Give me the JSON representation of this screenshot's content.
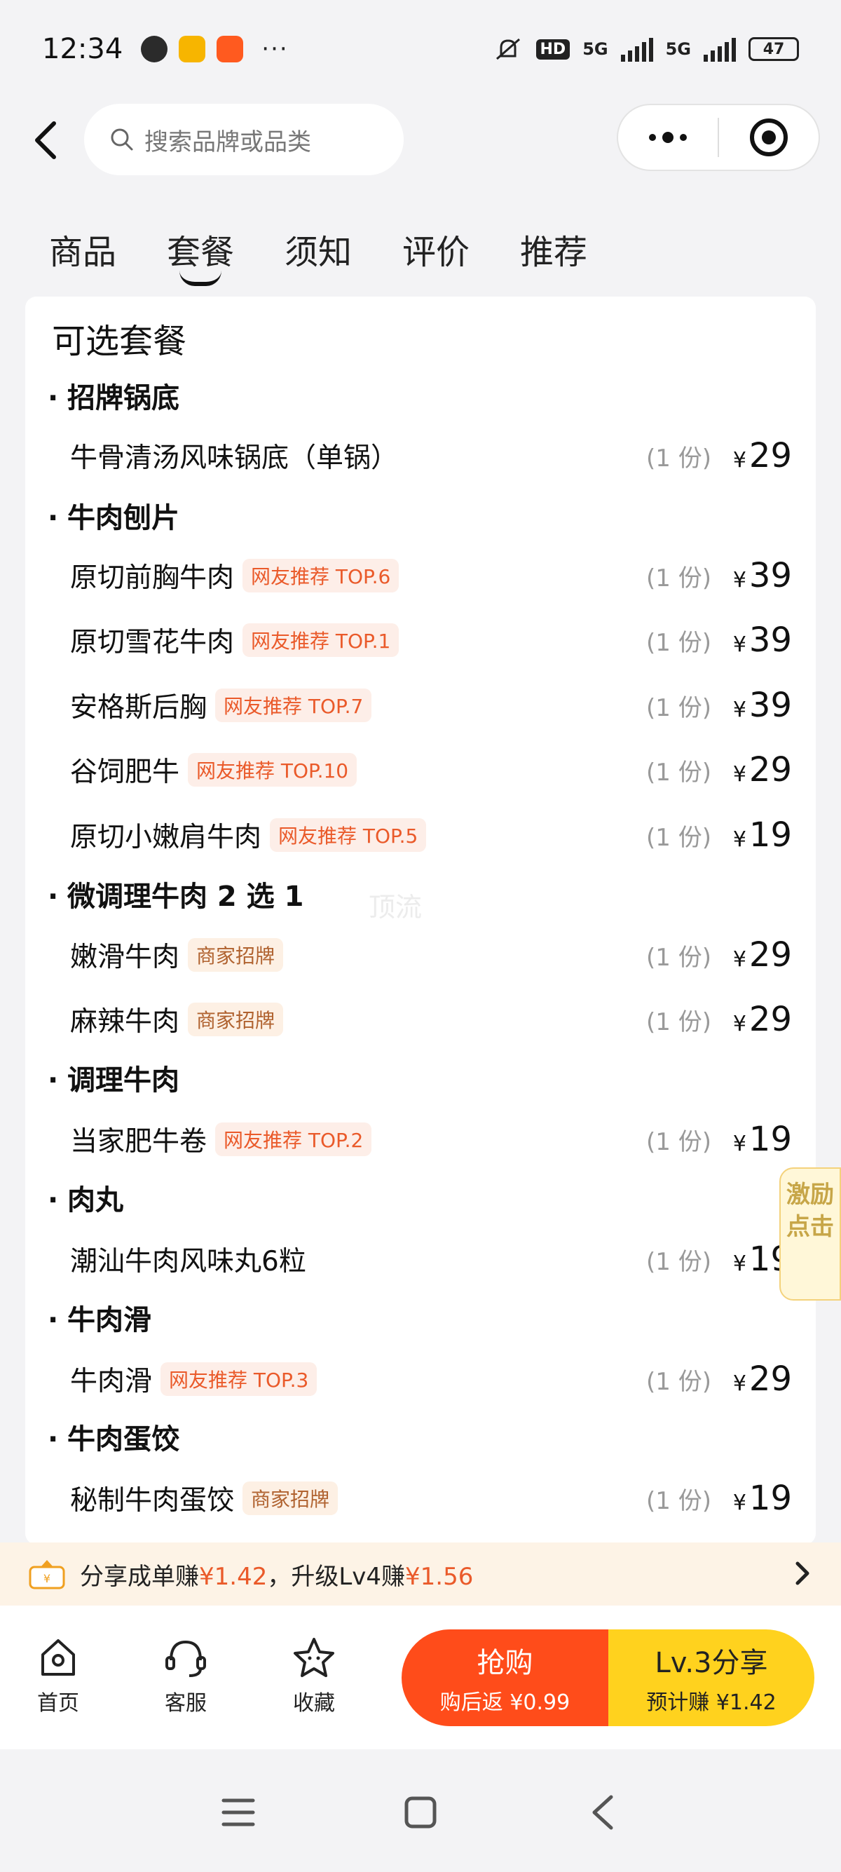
{
  "status_bar": {
    "time": "12:34",
    "more": "···",
    "network_1": "5G",
    "network_2": "5G",
    "hd": "HD",
    "battery": "47"
  },
  "header": {
    "search_placeholder": "搜索品牌或品类"
  },
  "tabs": [
    {
      "label": "商品"
    },
    {
      "label": "套餐"
    },
    {
      "label": "须知"
    },
    {
      "label": "评价"
    },
    {
      "label": "推荐"
    }
  ],
  "active_tab": "套餐",
  "menu": {
    "title": "可选套餐",
    "bullet": "·",
    "categories": [
      {
        "name": "招牌锅底"
      },
      {
        "name": "牛肉刨片"
      },
      {
        "name": "微调理牛肉 2 选 1"
      },
      {
        "name": "调理牛肉"
      },
      {
        "name": "肉丸"
      },
      {
        "name": "牛肉滑"
      },
      {
        "name": "牛肉蛋饺"
      }
    ],
    "items": [
      {
        "name": "牛骨清汤风味锅底（单锅）",
        "tag": "",
        "qty": "(1 份)",
        "currency": "¥",
        "price": "29"
      },
      {
        "name": "原切前胸牛肉",
        "tag": "网友推荐 TOP.6",
        "qty": "(1 份)",
        "currency": "¥",
        "price": "39"
      },
      {
        "name": "原切雪花牛肉",
        "tag": "网友推荐 TOP.1",
        "qty": "(1 份)",
        "currency": "¥",
        "price": "39"
      },
      {
        "name": "安格斯后胸",
        "tag": "网友推荐 TOP.7",
        "qty": "(1 份)",
        "currency": "¥",
        "price": "39"
      },
      {
        "name": "谷饲肥牛",
        "tag": "网友推荐 TOP.10",
        "qty": "(1 份)",
        "currency": "¥",
        "price": "29"
      },
      {
        "name": "原切小嫩肩牛肉",
        "tag": "网友推荐 TOP.5",
        "qty": "(1 份)",
        "currency": "¥",
        "price": "19"
      },
      {
        "name": "嫩滑牛肉",
        "tag": "商家招牌",
        "qty": "(1 份)",
        "currency": "¥",
        "price": "29"
      },
      {
        "name": "麻辣牛肉",
        "tag": "商家招牌",
        "qty": "(1 份)",
        "currency": "¥",
        "price": "29"
      },
      {
        "name": "当家肥牛卷",
        "tag": "网友推荐 TOP.2",
        "qty": "(1 份)",
        "currency": "¥",
        "price": "19"
      },
      {
        "name": "潮汕牛肉风味丸6粒",
        "tag": "",
        "qty": "(1 份)",
        "currency": "¥",
        "price": "19"
      },
      {
        "name": "牛肉滑",
        "tag": "网友推荐 TOP.3",
        "qty": "(1 份)",
        "currency": "¥",
        "price": "29"
      },
      {
        "name": "秘制牛肉蛋饺",
        "tag": "商家招牌",
        "qty": "(1 份)",
        "currency": "¥",
        "price": "19"
      }
    ],
    "watermark": "顶流"
  },
  "float_badge": {
    "line1": "激励",
    "line2": "点击"
  },
  "share_bar": {
    "prefix": "分享成单赚",
    "amount1": "¥1.42",
    "middle": "，升级Lv4赚",
    "amount2": "¥1.56"
  },
  "bottom_nav": [
    {
      "label": "首页",
      "icon": "home-icon"
    },
    {
      "label": "客服",
      "icon": "headset-icon"
    },
    {
      "label": "收藏",
      "icon": "star-icon"
    }
  ],
  "buy_button": {
    "label": "抢购",
    "sub": "购后返 ¥0.99"
  },
  "share_button": {
    "label": "Lv.3分享",
    "sub": "预计赚 ¥1.42"
  },
  "colors": {
    "accent_orange": "#ff4c1a",
    "accent_yellow": "#ffd21e",
    "tag_text": "#ea5a2a"
  }
}
